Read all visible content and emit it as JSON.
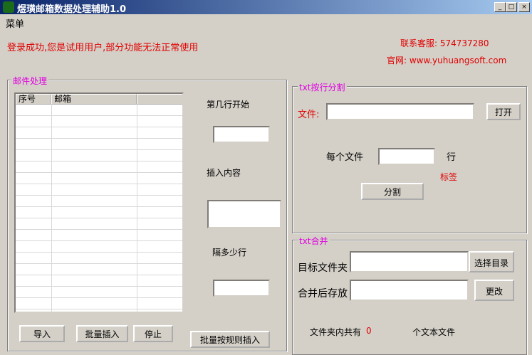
{
  "window": {
    "title": "煜璜邮箱数据处理辅助1.0",
    "min": "_",
    "max": "□",
    "close": "×"
  },
  "menu": {
    "label": "菜单"
  },
  "status": "登录成功,您是试用用户,部分功能无法正常使用",
  "contact": {
    "service": "联系客服: 574737280",
    "website": "官网: www.yuhuangsoft.com"
  },
  "mail": {
    "group": "邮件处理",
    "columns": [
      "序号",
      "邮箱",
      ""
    ],
    "start_row_label": "第几行开始",
    "insert_label": "插入内容",
    "interval_label": "隔多少行",
    "start_row": "",
    "insert_content": "",
    "interval": "",
    "import": "导入",
    "batch_insert": "批量插入",
    "stop": "停止",
    "batch_rule": "批量按规则插入"
  },
  "split": {
    "group": "txt按行分割",
    "file_label": "文件:",
    "file": "",
    "open": "打开",
    "per_file": "每个文件",
    "lines": "",
    "unit": "行",
    "tag": "标签",
    "split": "分割"
  },
  "merge": {
    "group": "txt合并",
    "target_label": "目标文件夹",
    "target": "",
    "choose": "选择目录",
    "save_label": "合并后存放",
    "save": "",
    "change": "更改",
    "count_prefix": "文件夹内共有",
    "count": "0",
    "count_suffix": "个文本文件"
  }
}
